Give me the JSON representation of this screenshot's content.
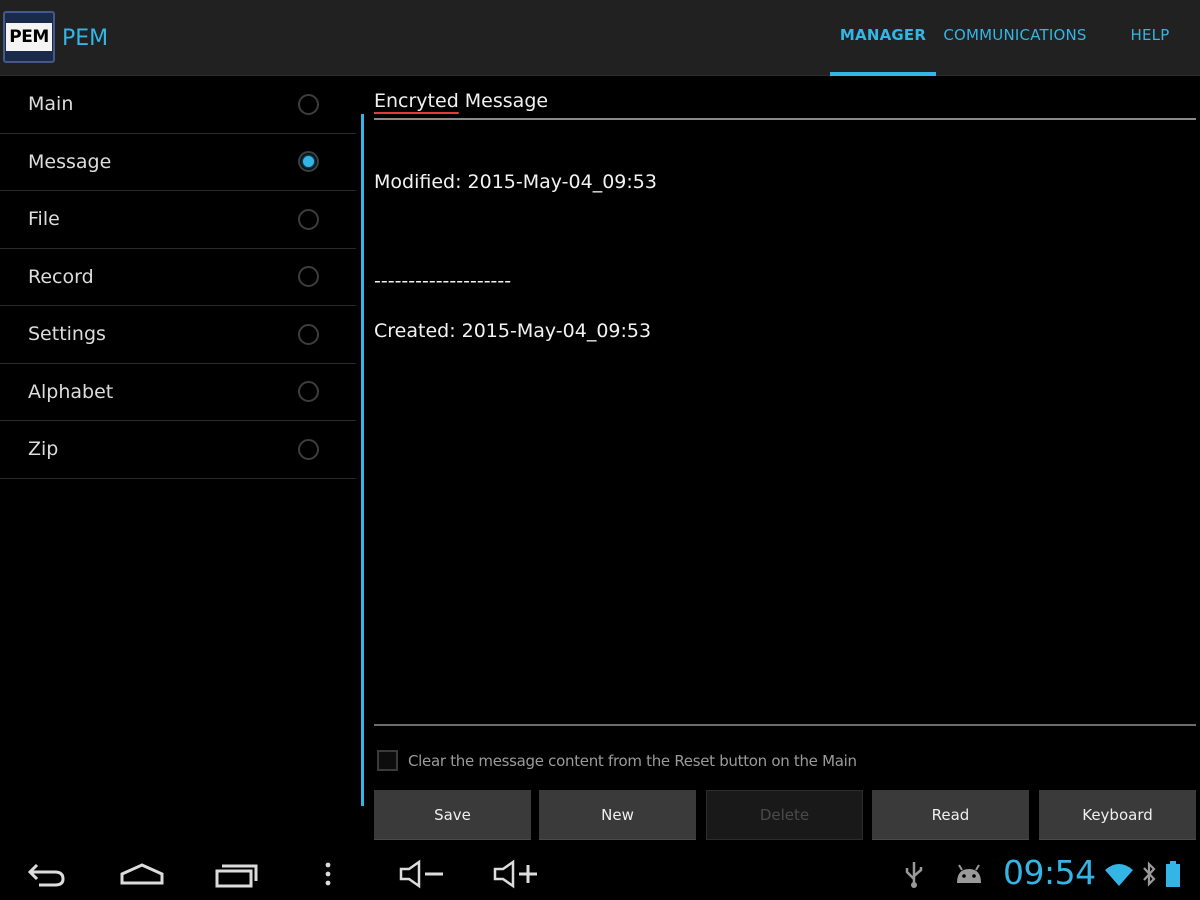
{
  "app": {
    "logo_text": "PEM",
    "title": "PEM"
  },
  "tabs": [
    {
      "label": "MANAGER",
      "active": true
    },
    {
      "label": "COMMUNICATIONS",
      "active": false
    },
    {
      "label": "HELP",
      "active": false
    }
  ],
  "sidebar": {
    "items": [
      {
        "label": "Main",
        "selected": false
      },
      {
        "label": "Message",
        "selected": true
      },
      {
        "label": "File",
        "selected": false
      },
      {
        "label": "Record",
        "selected": false
      },
      {
        "label": "Settings",
        "selected": false
      },
      {
        "label": "Alphabet",
        "selected": false
      },
      {
        "label": "Zip",
        "selected": false
      }
    ]
  },
  "content": {
    "header_misspelled": "Encryted",
    "header_rest": " Message",
    "modified": "Modified: 2015-May-04_09:53",
    "separator": "--------------------",
    "created": "Created: 2015-May-04_09:53",
    "clear_option": {
      "label": "Clear the message content from the Reset button on the Main",
      "checked": false
    },
    "buttons": {
      "save": "Save",
      "new": "New",
      "delete": "Delete",
      "read": "Read",
      "keyboard": "Keyboard"
    }
  },
  "system_bar": {
    "time": "09:54",
    "icons": [
      "back-icon",
      "home-icon",
      "recent-apps-icon",
      "overflow-menu-icon",
      "volume-down-icon",
      "volume-up-icon",
      "usb-icon",
      "android-debug-icon",
      "wifi-icon",
      "bluetooth-icon",
      "battery-icon"
    ]
  },
  "colors": {
    "accent": "#33b5e5",
    "actionbar": "#212121",
    "button": "#3a3a3a",
    "background": "#000000"
  }
}
